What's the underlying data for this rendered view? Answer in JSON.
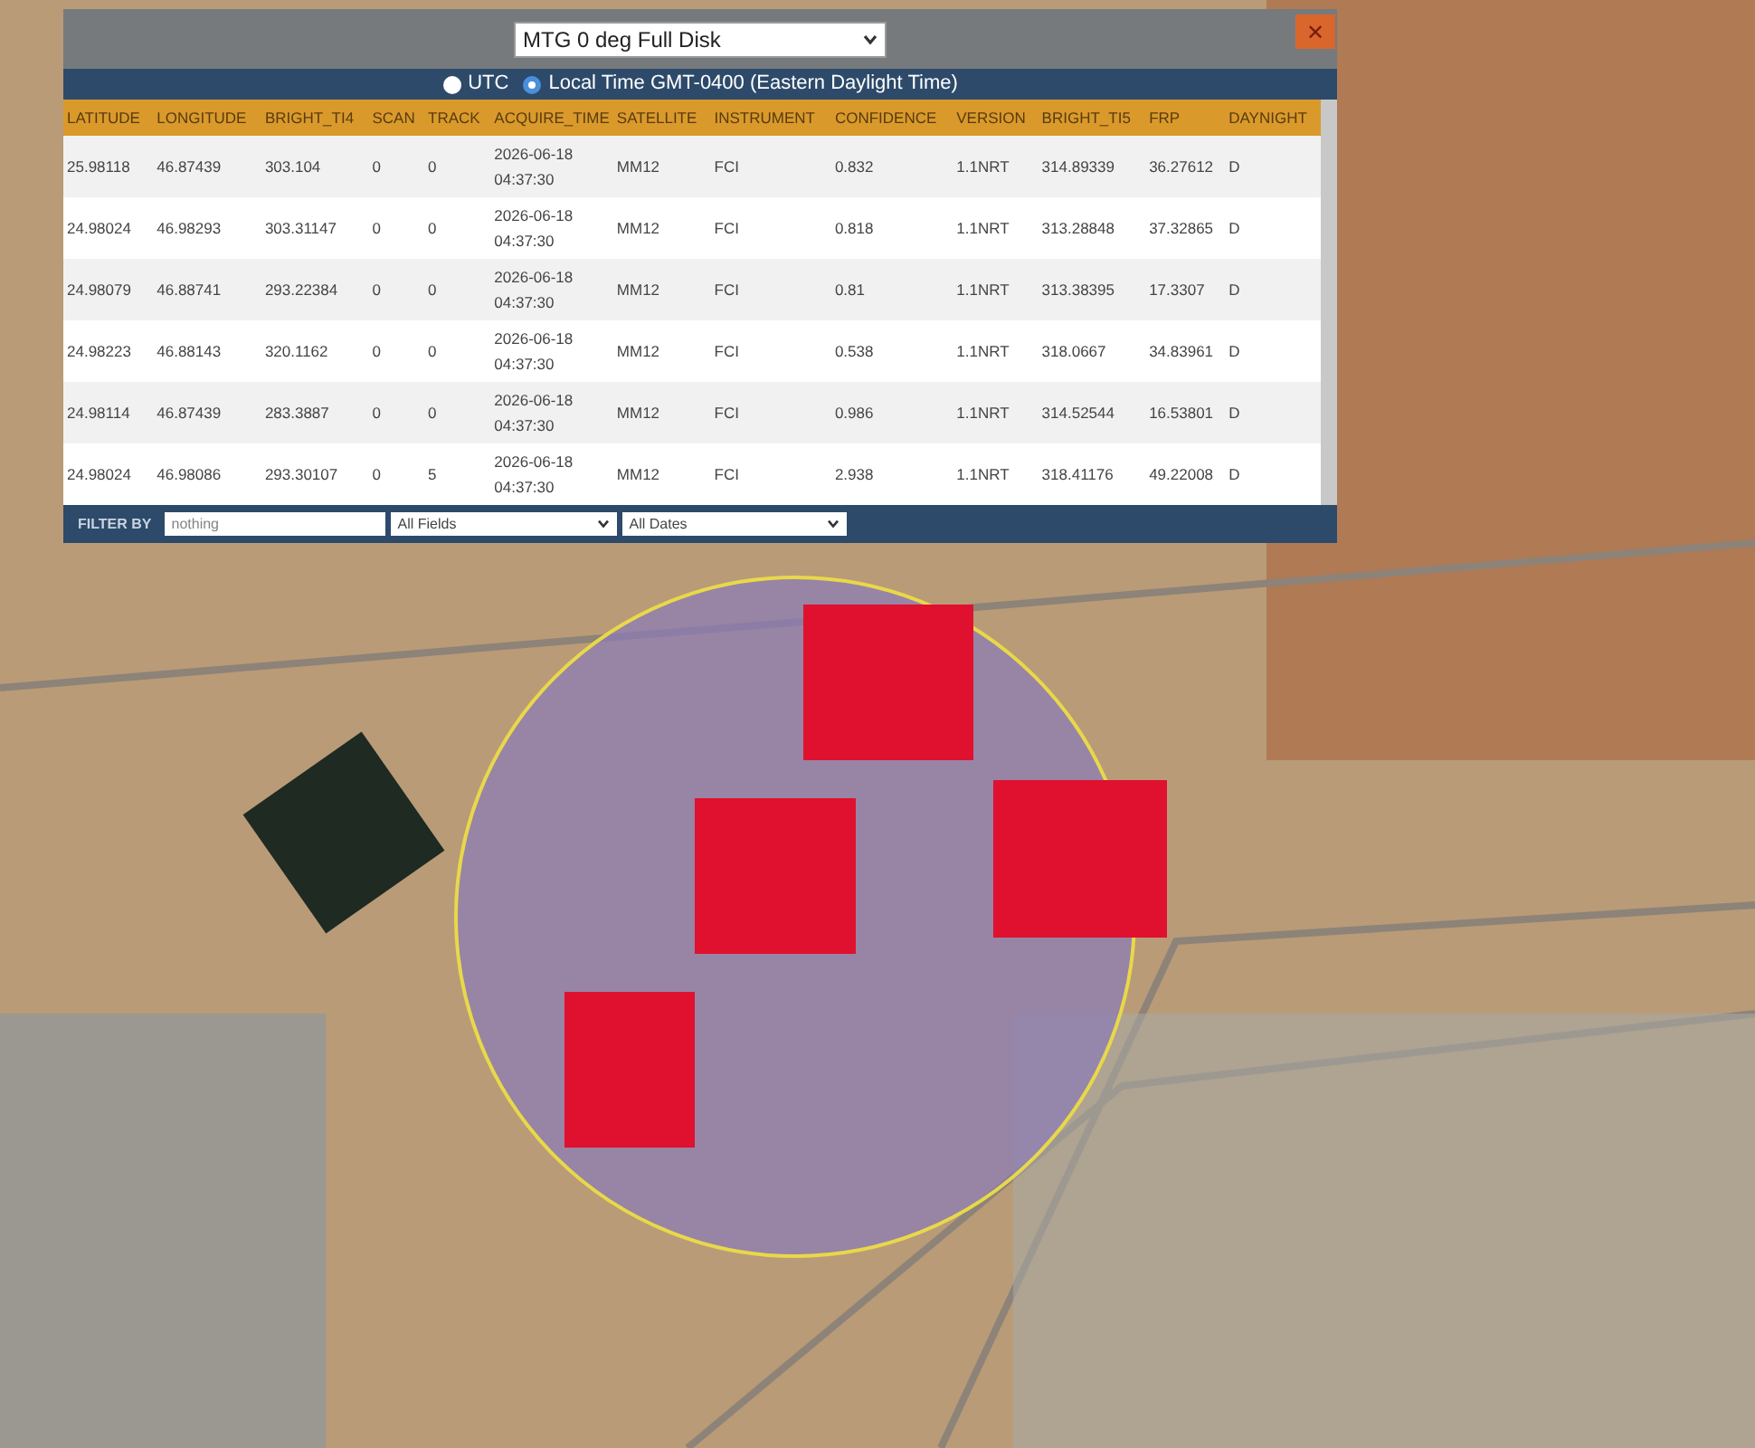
{
  "panel": {
    "source_select": {
      "value": "MTG 0 deg Full Disk"
    },
    "close_label": "✕",
    "time_options": [
      {
        "label": "UTC",
        "selected": false
      },
      {
        "label": "Local Time GMT-0400 (Eastern Daylight Time)",
        "selected": true
      }
    ],
    "table": {
      "columns": [
        "LATITUDE",
        "LONGITUDE",
        "BRIGHT_TI4",
        "SCAN",
        "TRACK",
        "ACQUIRE_TIME",
        "SATELLITE",
        "INSTRUMENT",
        "CONFIDENCE",
        "VERSION",
        "BRIGHT_TI5",
        "FRP",
        "DAYNIGHT"
      ],
      "rows": [
        [
          "25.98118",
          "46.87439",
          "303.104",
          "0",
          "0",
          "2026-06-18 04:37:30",
          "MM12",
          "FCI",
          "0.832",
          "1.1NRT",
          "314.89339",
          "36.27612",
          "D"
        ],
        [
          "24.98024",
          "46.98293",
          "303.31147",
          "0",
          "0",
          "2026-06-18 04:37:30",
          "MM12",
          "FCI",
          "0.818",
          "1.1NRT",
          "313.28848",
          "37.32865",
          "D"
        ],
        [
          "24.98079",
          "46.88741",
          "293.22384",
          "0",
          "0",
          "2026-06-18 04:37:30",
          "MM12",
          "FCI",
          "0.81",
          "1.1NRT",
          "313.38395",
          "17.3307",
          "D"
        ],
        [
          "24.98223",
          "46.88143",
          "320.1162",
          "0",
          "0",
          "2026-06-18 04:37:30",
          "MM12",
          "FCI",
          "0.538",
          "1.1NRT",
          "318.0667",
          "34.83961",
          "D"
        ],
        [
          "24.98114",
          "46.87439",
          "283.3887",
          "0",
          "0",
          "2026-06-18 04:37:30",
          "MM12",
          "FCI",
          "0.986",
          "1.1NRT",
          "314.52544",
          "16.53801",
          "D"
        ],
        [
          "24.98024",
          "46.98086",
          "293.30107",
          "0",
          "5",
          "2026-06-18 04:37:30",
          "MM12",
          "FCI",
          "2.938",
          "1.1NRT",
          "318.41176",
          "49.22008",
          "D"
        ]
      ]
    },
    "filter": {
      "label": "FILTER BY",
      "placeholder": "nothing",
      "field_select": "All Fields",
      "date_select": "All Dates"
    }
  }
}
